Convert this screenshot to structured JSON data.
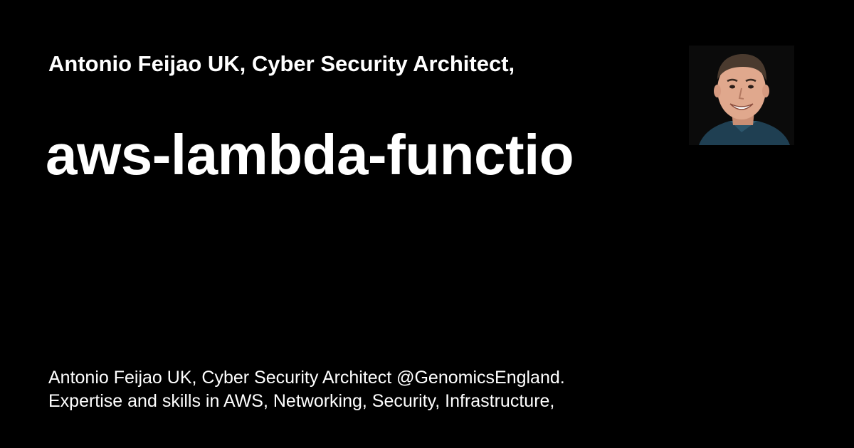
{
  "card": {
    "site_title": "Antonio Feijao UK, Cyber Security Architect,",
    "headline": "aws-lambda-functio",
    "description_lines": [
      "Antonio Feijao UK, Cyber Security Architect @GenomicsEngland.",
      "Expertise and skills in AWS, Networking, Security, Infrastructure,"
    ]
  },
  "colors": {
    "background": "#000000",
    "text": "#ffffff"
  },
  "icons": {
    "avatar": "profile-photo"
  }
}
